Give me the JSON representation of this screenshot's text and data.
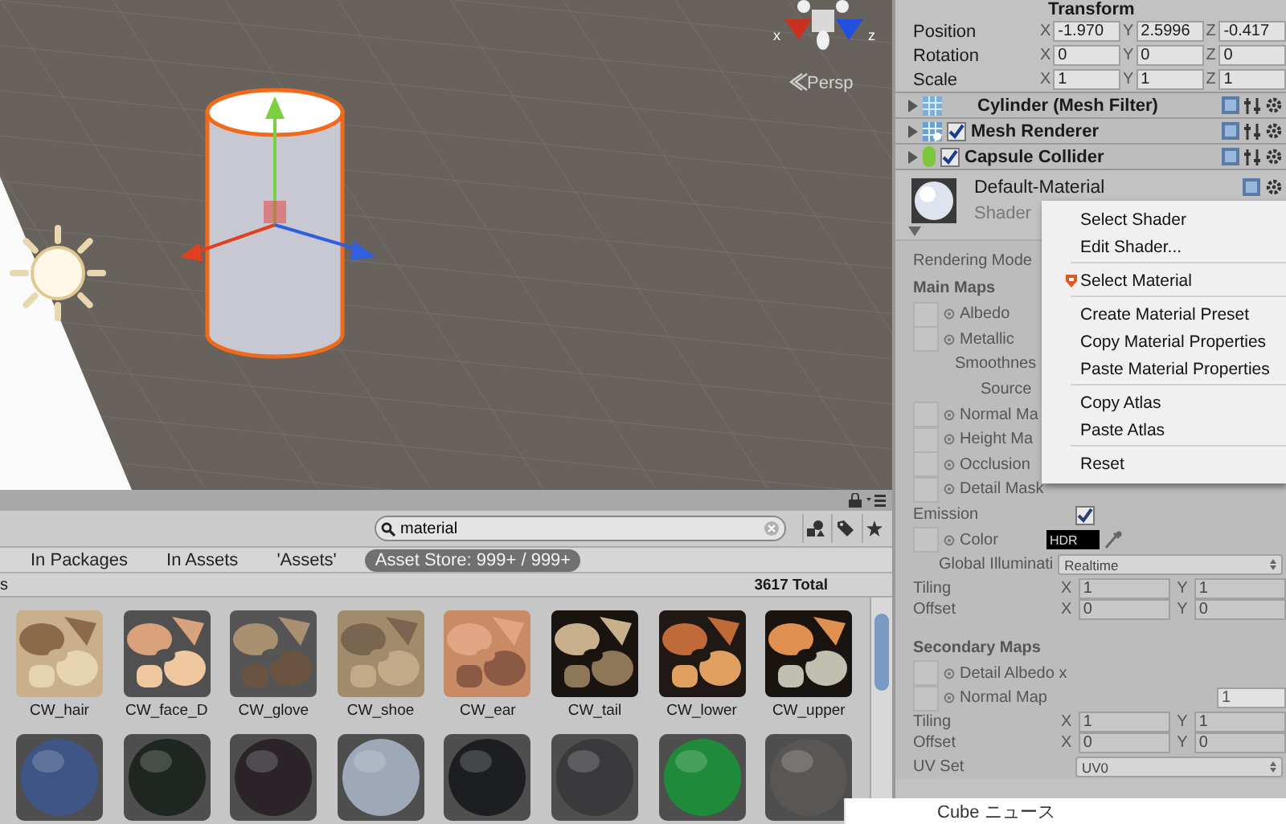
{
  "scene": {
    "axis_labels": [
      "x",
      "z"
    ],
    "view_label": "Persp"
  },
  "project": {
    "search": {
      "value": "material"
    },
    "filters": [
      {
        "label": "In Packages",
        "selected": false
      },
      {
        "label": "In Assets",
        "selected": false
      },
      {
        "label": "'Assets'",
        "selected": false
      },
      {
        "label": "Asset Store: 999+ / 999+",
        "selected": true
      }
    ],
    "header_left": "s",
    "total": "3617 Total",
    "assets": [
      {
        "name": "CW_hair",
        "kind": "picture"
      },
      {
        "name": "CW_face_D",
        "kind": "picture"
      },
      {
        "name": "CW_glove",
        "kind": "picture"
      },
      {
        "name": "CW_shoe",
        "kind": "picture"
      },
      {
        "name": "CW_ear",
        "kind": "picture"
      },
      {
        "name": "CW_tail",
        "kind": "picture"
      },
      {
        "name": "CW_lower",
        "kind": "picture"
      },
      {
        "name": "CW_upper",
        "kind": "picture"
      }
    ],
    "materials": [
      {
        "color": "#3e5586"
      },
      {
        "color": "#1f2620"
      },
      {
        "color": "#2a2428"
      },
      {
        "color": "#9ea8b8"
      },
      {
        "color": "#1c1e22"
      },
      {
        "color": "#3a3a3c"
      },
      {
        "color": "#1f8a3a"
      },
      {
        "color": "#5a5654"
      }
    ]
  },
  "inspector": {
    "transform": {
      "title": "Transform",
      "rows": [
        {
          "label": "Position",
          "fields": [
            {
              "axis": "X",
              "value": "-1.970"
            },
            {
              "axis": "Y",
              "value": "2.5996"
            },
            {
              "axis": "Z",
              "value": "-0.417"
            }
          ]
        },
        {
          "label": "Rotation",
          "fields": [
            {
              "axis": "X",
              "value": "0"
            },
            {
              "axis": "Y",
              "value": "0"
            },
            {
              "axis": "Z",
              "value": "0"
            }
          ]
        },
        {
          "label": "Scale",
          "fields": [
            {
              "axis": "X",
              "value": "1"
            },
            {
              "axis": "Y",
              "value": "1"
            },
            {
              "axis": "Z",
              "value": "1"
            }
          ]
        }
      ]
    },
    "components": [
      {
        "name": "Cylinder (Mesh Filter)",
        "kind": "mesh-filter"
      },
      {
        "name": "Mesh Renderer",
        "kind": "mesh-renderer",
        "enabled": true
      },
      {
        "name": "Capsule Collider",
        "kind": "collider",
        "enabled": true
      }
    ],
    "material": {
      "name": "Default-Material",
      "shader_label": "Shader"
    },
    "properties": [
      {
        "kind": "label",
        "label": "Rendering Mode"
      },
      {
        "kind": "section",
        "label": "Main Maps"
      },
      {
        "kind": "map",
        "label": "Albedo"
      },
      {
        "kind": "map",
        "label": "Metallic"
      },
      {
        "kind": "sub",
        "label": "Smoothnes"
      },
      {
        "kind": "sub2",
        "label": "Source"
      },
      {
        "kind": "map",
        "label": "Normal Ma"
      },
      {
        "kind": "map",
        "label": "Height Ma"
      },
      {
        "kind": "map",
        "label": "Occlusion"
      },
      {
        "kind": "map",
        "label": "Detail Mask"
      },
      {
        "kind": "toggle",
        "label": "Emission",
        "checked": true
      },
      {
        "kind": "color",
        "label": "Color",
        "swatch": "HDR"
      },
      {
        "kind": "dropdown",
        "label": "Global Illuminati",
        "value": "Realtime"
      },
      {
        "kind": "vector",
        "label": "Tiling",
        "fields": [
          {
            "axis": "X",
            "value": "1"
          },
          {
            "axis": "Y",
            "value": "1"
          }
        ]
      },
      {
        "kind": "vector",
        "label": "Offset",
        "fields": [
          {
            "axis": "X",
            "value": "0"
          },
          {
            "axis": "Y",
            "value": "0"
          }
        ]
      },
      {
        "kind": "spacer"
      },
      {
        "kind": "section",
        "label": "Secondary Maps"
      },
      {
        "kind": "map",
        "label": "Detail Albedo x"
      },
      {
        "kind": "map",
        "label": "Normal Map",
        "value": "1"
      },
      {
        "kind": "vector",
        "label": "Tiling",
        "fields": [
          {
            "axis": "X",
            "value": "1"
          },
          {
            "axis": "Y",
            "value": "1"
          }
        ]
      },
      {
        "kind": "vector",
        "label": "Offset",
        "fields": [
          {
            "axis": "X",
            "value": "0"
          },
          {
            "axis": "Y",
            "value": "0"
          }
        ]
      },
      {
        "kind": "dropdown",
        "label": "UV Set",
        "value": "UV0"
      }
    ]
  },
  "context_menu": {
    "groups": [
      {
        "items": [
          {
            "label": "Select Shader",
            "kind": "plain"
          },
          {
            "label": "Edit Shader...",
            "kind": "plain"
          }
        ]
      },
      {
        "items": [
          {
            "label": "Select Material",
            "kind": "badge"
          }
        ]
      },
      {
        "items": [
          {
            "label": "Create Material Preset",
            "kind": "plain"
          },
          {
            "label": "Copy Material Properties",
            "kind": "plain"
          },
          {
            "label": "Paste Material Properties",
            "kind": "plain"
          }
        ]
      },
      {
        "items": [
          {
            "label": "Copy Atlas",
            "kind": "plain"
          },
          {
            "label": "Paste Atlas",
            "kind": "plain"
          }
        ]
      },
      {
        "items": [
          {
            "label": "Reset",
            "kind": "plain"
          }
        ]
      }
    ]
  },
  "notification": {
    "title": "Cube ニュース"
  }
}
